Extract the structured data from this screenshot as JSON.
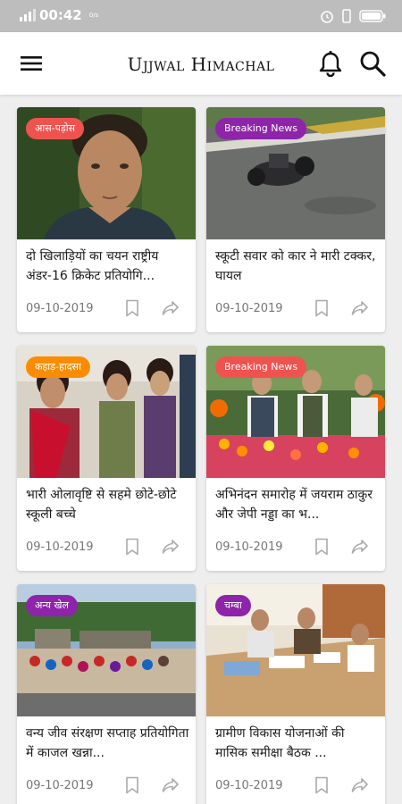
{
  "status_bar": {
    "time": "00:42",
    "net_speed": "0/s"
  },
  "header": {
    "title": "Ujjwal Himachal"
  },
  "articles": [
    {
      "tag": "आस-पड़ोस",
      "tag_color": "#ef5350",
      "headline": "दो खिलाड़ियों का चयन राष्ट्रीय अंडर-16 क्रिकेट प्रतियोगि...",
      "date": "09-10-2019"
    },
    {
      "tag": "Breaking News",
      "tag_color": "#8e24aa",
      "headline": "स्कूटी सवार को कार ने मारी टक्कर, घायल",
      "date": "09-10-2019"
    },
    {
      "tag": "कहाड़-हादसा",
      "tag_color": "#fb8c00",
      "headline": "भारी ओलावृष्टि से सहमे छोटे-छोटे स्कूली बच्चे",
      "date": "09-10-2019"
    },
    {
      "tag": "Breaking News",
      "tag_color": "#ef5350",
      "headline": "अभिनंदन समारोह में जयराम ठाकुर और जेपी नड्डा का भ...",
      "date": "09-10-2019"
    },
    {
      "tag": "अन्य खेल",
      "tag_color": "#8e24aa",
      "headline": "वन्य जीव संरक्षण सप्ताह प्रतियोगिता में  काजल खन्ना...",
      "date": "09-10-2019"
    },
    {
      "tag": "चम्बा",
      "tag_color": "#8e24aa",
      "headline": "ग्रामीण विकास योजनाओं की मासिक समीक्षा बैठक ...",
      "date": "09-10-2019"
    }
  ]
}
